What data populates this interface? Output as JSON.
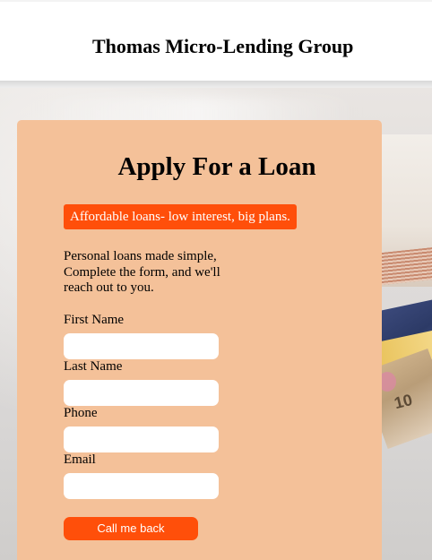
{
  "header": {
    "title": "Thomas Micro-Lending Group"
  },
  "form": {
    "title": "Apply For a Loan",
    "tagline": "Affordable loans- low interest, big plans.",
    "intro": "Personal loans made simple, Complete the form, and we'll reach out to you.",
    "fields": [
      {
        "label": "First Name",
        "value": "",
        "placeholder": ""
      },
      {
        "label": "Last Name",
        "value": "",
        "placeholder": ""
      },
      {
        "label": "Phone",
        "value": "",
        "placeholder": ""
      },
      {
        "label": "Email",
        "value": "",
        "placeholder": ""
      }
    ],
    "submit_label": "Call me back"
  },
  "background": {
    "banknote_value": "10"
  },
  "colors": {
    "accent": "#ff4f0a",
    "card": "#f4c199",
    "header_bg": "#ffffff"
  }
}
